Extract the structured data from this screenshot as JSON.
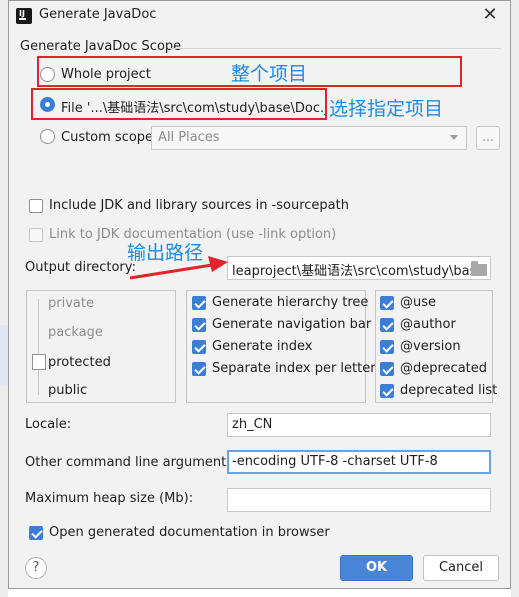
{
  "window": {
    "title": "Generate JavaDoc",
    "app_icon": "intellij-icon"
  },
  "scope": {
    "heading": "Generate JavaDoc Scope",
    "whole_project": "Whole project",
    "file": "File '...\\基础语法\\src\\com\\study\\base\\Doc.java'",
    "custom_scope": "Custom scope",
    "custom_scope_value": "All Places",
    "browse_label": "..."
  },
  "options": {
    "include_jdk": "Include JDK and library sources in -sourcepath",
    "link_jdk": "Link to JDK documentation (use -link option)"
  },
  "output": {
    "label": "Output directory:",
    "value": "leaproject\\基础语法\\src\\com\\study\\base"
  },
  "visibility": {
    "levels": [
      "private",
      "package",
      "protected",
      "public"
    ],
    "selected": "protected"
  },
  "generate": {
    "hierarchy": "Generate hierarchy tree",
    "navigation": "Generate navigation bar",
    "index": "Generate index",
    "separate_index": "Separate index per letter"
  },
  "tags": {
    "use": "@use",
    "author": "@author",
    "version": "@version",
    "deprecated": "@deprecated",
    "deprecated_list": "deprecated list"
  },
  "locale": {
    "label": "Locale:",
    "value": "zh_CN"
  },
  "other_args": {
    "label": "Other command line arguments:",
    "value": "-encoding UTF-8 -charset UTF-8"
  },
  "heap": {
    "label": "Maximum heap size (Mb):",
    "value": ""
  },
  "open_in_browser": "Open generated documentation in browser",
  "buttons": {
    "ok": "OK",
    "cancel": "Cancel",
    "help": "?"
  },
  "annotations": {
    "whole_project_note": "整个项目",
    "file_note": "选择指定项目",
    "output_note": "输出路径"
  },
  "colors": {
    "accent": "#3b7fd4",
    "annotation_red": "#e0242a",
    "annotation_blue": "#1c8be8"
  }
}
